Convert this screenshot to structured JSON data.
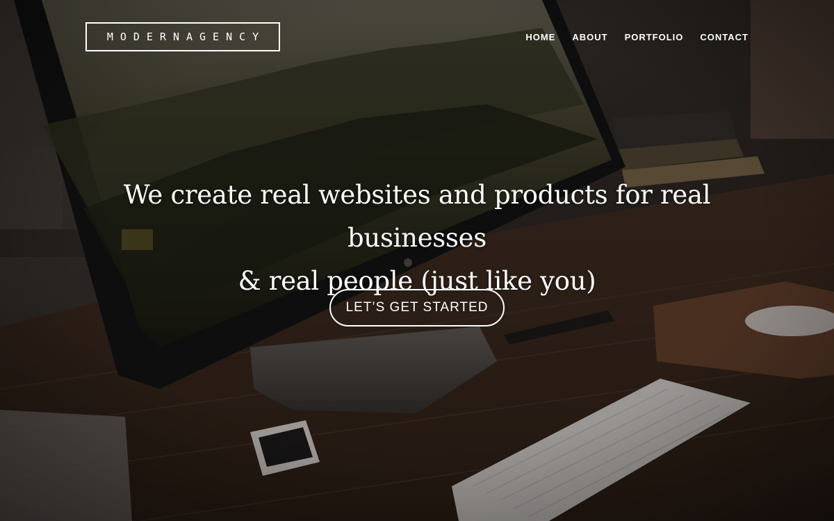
{
  "header": {
    "logo_text": "MODERNAGENCY",
    "nav": [
      {
        "label": "HOME"
      },
      {
        "label": "ABOUT"
      },
      {
        "label": "PORTFOLIO"
      },
      {
        "label": "CONTACT"
      }
    ]
  },
  "hero": {
    "headline_line1": "We create real websites and products for real businesses",
    "headline_line2": "& real people (just like you)",
    "cta_label": "LET’S GET STARTED"
  },
  "colors": {
    "text": "#ffffff",
    "background_dark": "#1b1714",
    "desk_wood": "#4a3326"
  }
}
